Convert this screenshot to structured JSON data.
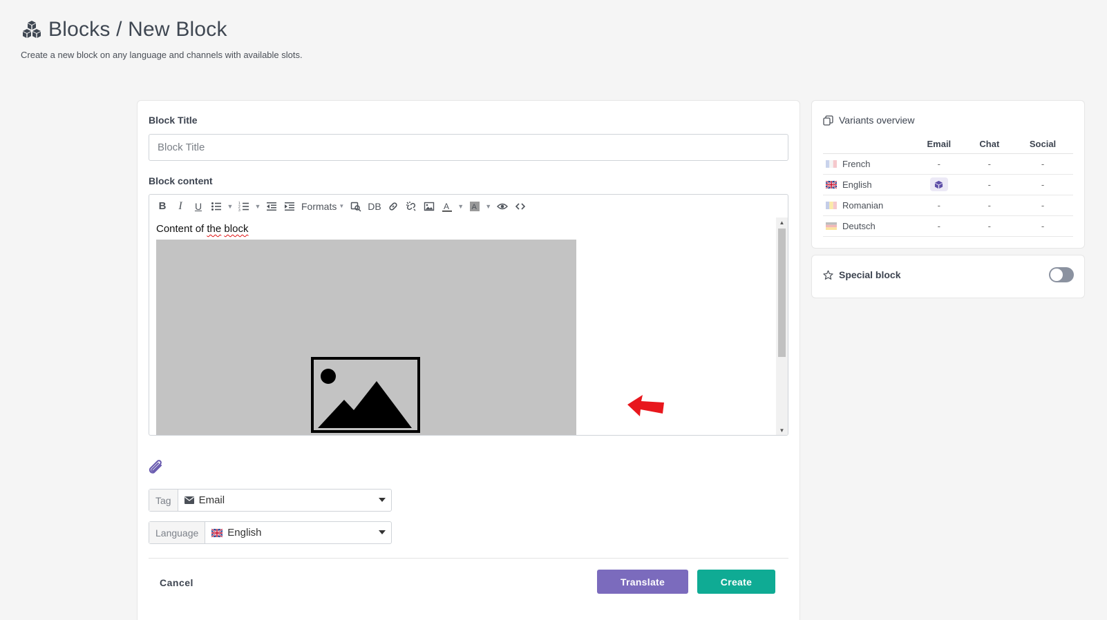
{
  "header": {
    "title": "Blocks / New Block",
    "subtitle": "Create a new block on any language and channels with available slots."
  },
  "form": {
    "title_label": "Block Title",
    "title_placeholder": "Block Title",
    "content_label": "Block content",
    "toolbar": {
      "formats_label": "Formats",
      "db_label": "DB"
    },
    "content_text_prefix": "Content of ",
    "content_text_spell1": "the",
    "content_text_space": " ",
    "content_text_spell2": "block",
    "tag_label": "Tag",
    "tag_value": "Email",
    "language_label": "Language",
    "language_value": "English",
    "cancel_label": "Cancel",
    "translate_label": "Translate",
    "create_label": "Create"
  },
  "variants": {
    "title": "Variants overview",
    "columns": [
      "Email",
      "Chat",
      "Social"
    ],
    "rows": [
      {
        "language": "French",
        "email": "-",
        "chat": "-",
        "social": "-"
      },
      {
        "language": "English",
        "email": "",
        "chat": "-",
        "social": "-"
      },
      {
        "language": "Romanian",
        "email": "-",
        "chat": "-",
        "social": "-"
      },
      {
        "language": "Deutsch",
        "email": "-",
        "chat": "-",
        "social": "-"
      }
    ]
  },
  "special": {
    "label": "Special block",
    "enabled": false
  },
  "colors": {
    "translate": "#7b6bbd",
    "create": "#0fab94",
    "toggle_off": "#8b92a0"
  }
}
